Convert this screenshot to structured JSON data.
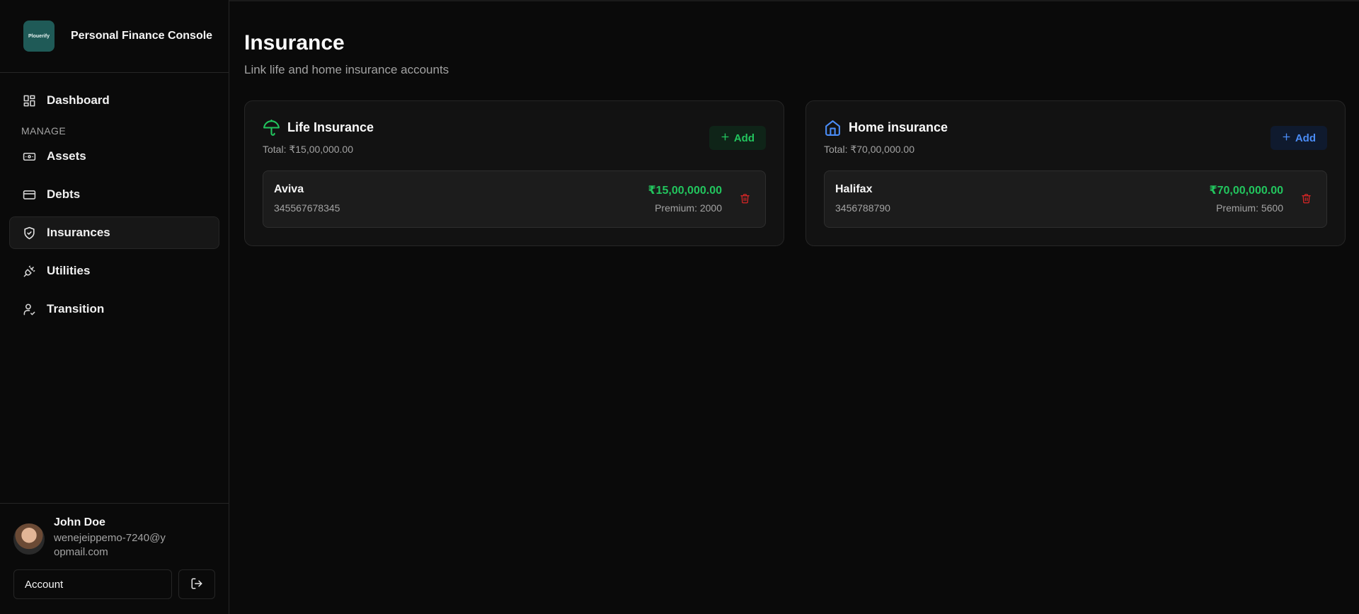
{
  "app": {
    "logo_text": "Plouerify",
    "title": "Personal Finance Console"
  },
  "sidebar": {
    "dashboard": {
      "label": "Dashboard",
      "icon": "dashboard-icon"
    },
    "section_manage": "MANAGE",
    "items": [
      {
        "label": "Assets",
        "icon": "banknote-icon"
      },
      {
        "label": "Debts",
        "icon": "credit-card-icon"
      },
      {
        "label": "Insurances",
        "icon": "shield-check-icon",
        "active": true
      },
      {
        "label": "Utilities",
        "icon": "plug-icon"
      },
      {
        "label": "Transition",
        "icon": "user-check-icon"
      }
    ]
  },
  "user": {
    "name": "John Doe",
    "email": "wenejeippemo-7240@yopmail.com",
    "account_label": "Account"
  },
  "page": {
    "title": "Insurance",
    "subtitle": "Link life and home insurance accounts"
  },
  "cards": {
    "life": {
      "title": "Life Insurance",
      "total": "Total: ₹15,00,000.00",
      "add_label": "Add",
      "icon": "umbrella-icon",
      "accent": "#22c55e",
      "policy": {
        "name": "Aviva",
        "number": "345567678345",
        "amount": "₹15,00,000.00",
        "premium": "Premium: 2000"
      }
    },
    "home": {
      "title": "Home insurance",
      "total": "Total: ₹70,00,000.00",
      "add_label": "Add",
      "icon": "house-icon",
      "accent": "#4a8cf6",
      "policy": {
        "name": "Halifax",
        "number": "3456788790",
        "amount": "₹70,00,000.00",
        "premium": "Premium: 5600"
      }
    }
  },
  "colors": {
    "background": "#0a0a0a",
    "card": "#121212",
    "amount_green": "#22c55e",
    "delete_red": "#dc2626"
  }
}
